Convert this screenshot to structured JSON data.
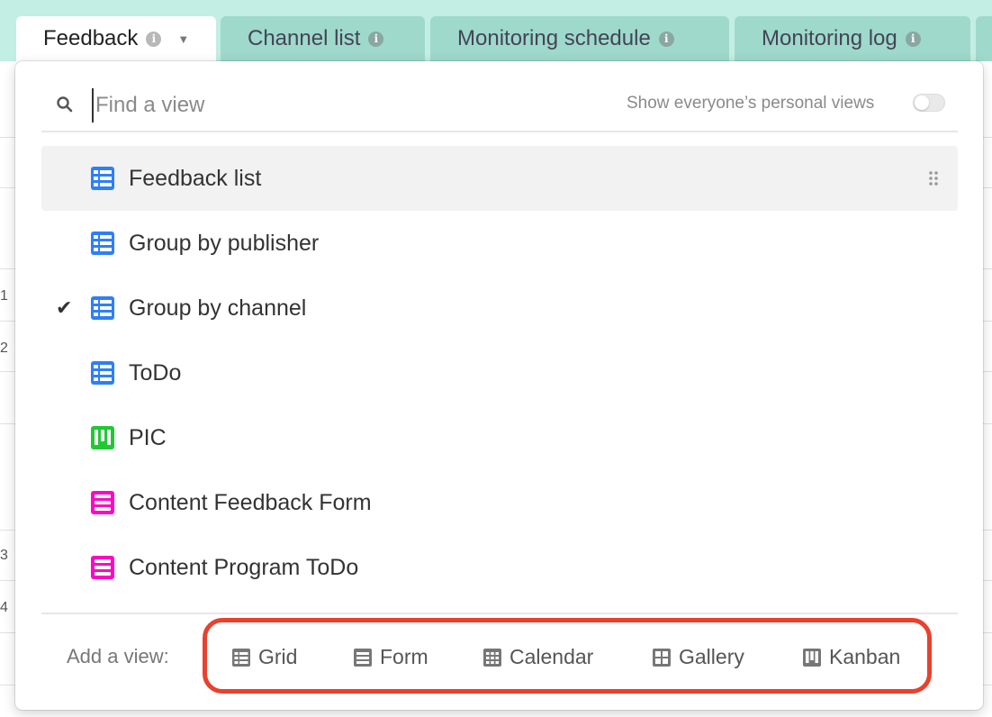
{
  "tabs": [
    {
      "label": "Feedback",
      "active": true
    },
    {
      "label": "Channel list",
      "active": false
    },
    {
      "label": "Monitoring schedule",
      "active": false
    },
    {
      "label": "Monitoring log",
      "active": false
    }
  ],
  "background": {
    "row_numbers": [
      "1",
      "2",
      "3",
      "4"
    ]
  },
  "search": {
    "placeholder": "Find a view",
    "value": ""
  },
  "personal_views": {
    "label": "Show everyone’s personal views",
    "enabled": false
  },
  "views": [
    {
      "label": "Feedback list",
      "type": "grid",
      "icon": "grid-view-icon",
      "color": "#2d7ff9",
      "selected": false,
      "hovered": true
    },
    {
      "label": "Group by publisher",
      "type": "grid",
      "icon": "grid-view-icon",
      "color": "#2d7ff9",
      "selected": false
    },
    {
      "label": "Group by channel",
      "type": "grid",
      "icon": "grid-view-icon",
      "color": "#2d7ff9",
      "selected": true
    },
    {
      "label": "ToDo",
      "type": "grid",
      "icon": "grid-view-icon",
      "color": "#2d7ff9",
      "selected": false
    },
    {
      "label": "PIC",
      "type": "kanban",
      "icon": "kanban-view-icon",
      "color": "#20c933",
      "selected": false
    },
    {
      "label": "Content Feedback Form",
      "type": "form",
      "icon": "form-view-icon",
      "color": "#ff08c2",
      "selected": false
    },
    {
      "label": "Content Program ToDo",
      "type": "form",
      "icon": "form-view-icon",
      "color": "#ff08c2",
      "selected": false
    }
  ],
  "add_view": {
    "label": "Add a view:",
    "options": [
      {
        "label": "Grid",
        "icon": "grid-icon"
      },
      {
        "label": "Form",
        "icon": "form-icon"
      },
      {
        "label": "Calendar",
        "icon": "calendar-icon"
      },
      {
        "label": "Gallery",
        "icon": "gallery-icon"
      },
      {
        "label": "Kanban",
        "icon": "kanban-icon"
      }
    ]
  },
  "colors": {
    "tabbar": "#c3eee3",
    "highlight": "#e8412d"
  }
}
